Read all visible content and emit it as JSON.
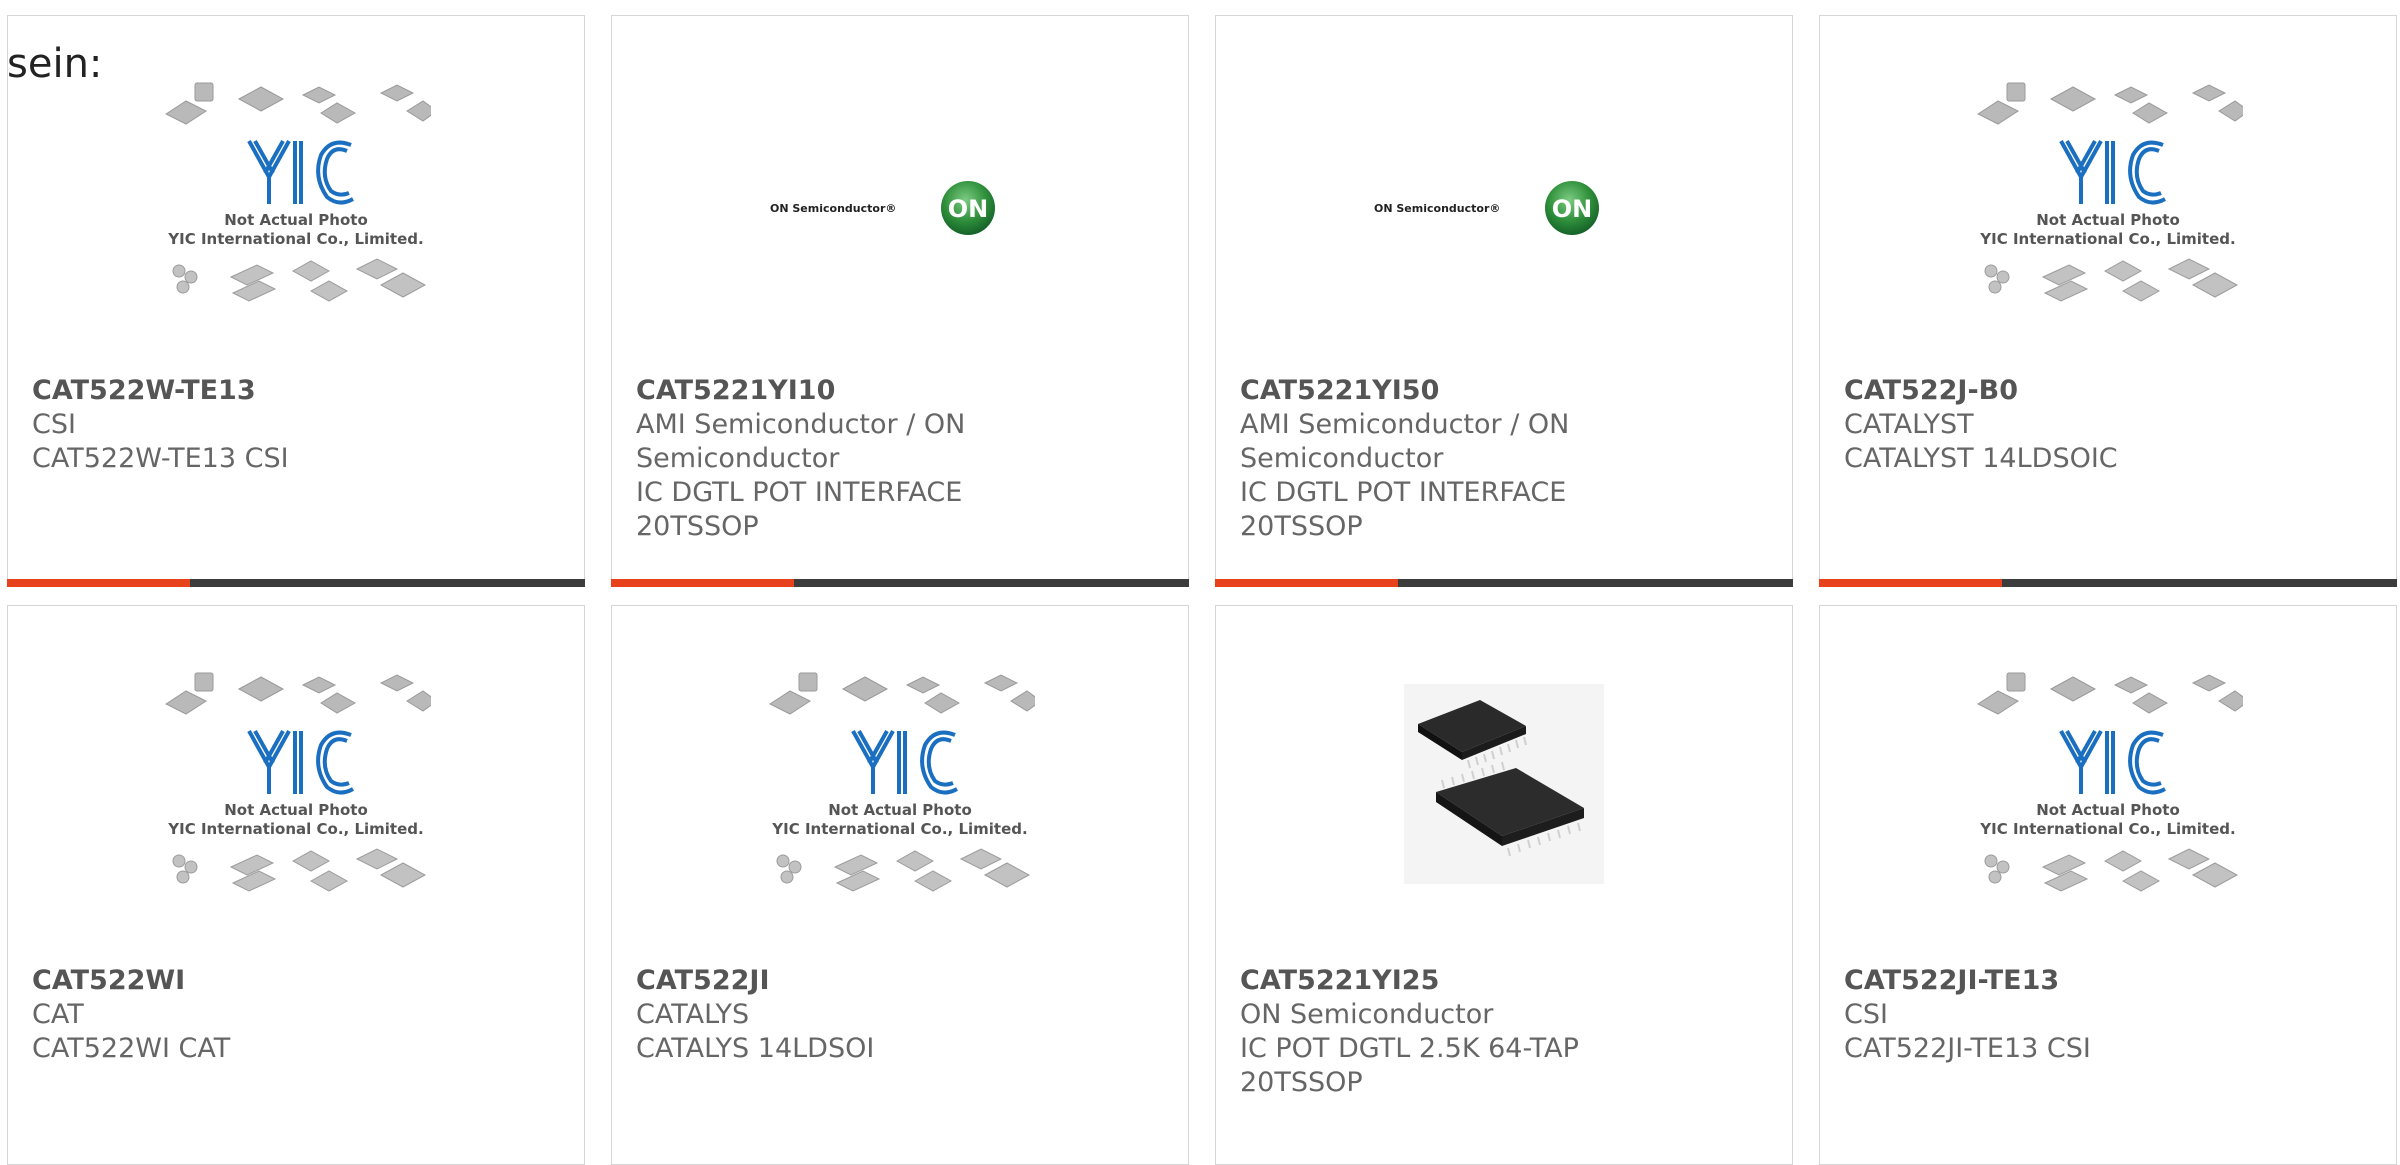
{
  "intro_text": "sein:",
  "colors": {
    "accent": "#e8421c",
    "bar": "#3c3c3c",
    "on_logo_green": "#2e8f3a",
    "yic_blue": "#1a6fc0"
  },
  "placeholder_image": {
    "logo_text": "YIC",
    "caption_line1": "Not Actual Photo",
    "caption_line2": "YIC International Co., Limited."
  },
  "on_logo": {
    "wordmark": "ON Semiconductor®",
    "badge": "ON"
  },
  "cards": [
    {
      "part": "CAT522W-TE13",
      "maker": "CSI",
      "desc": "CAT522W-TE13 CSI",
      "image": "yic-placeholder"
    },
    {
      "part": "CAT5221YI10",
      "maker": "AMI Semiconductor / ON Semiconductor",
      "desc": "IC DGTL POT INTERFACE 20TSSOP",
      "image": "on-semi-logo"
    },
    {
      "part": "CAT5221YI50",
      "maker": "AMI Semiconductor / ON Semiconductor",
      "desc": "IC DGTL POT INTERFACE 20TSSOP",
      "image": "on-semi-logo"
    },
    {
      "part": "CAT522J-B0",
      "maker": "CATALYST",
      "desc": "CATALYST 14LDSOIC",
      "image": "yic-placeholder"
    },
    {
      "part": "CAT522WI",
      "maker": "CAT",
      "desc": "CAT522WI CAT",
      "image": "yic-placeholder"
    },
    {
      "part": "CAT522JI",
      "maker": "CATALYS",
      "desc": "CATALYS 14LDSOI",
      "image": "yic-placeholder"
    },
    {
      "part": "CAT5221YI25",
      "maker": "ON Semiconductor",
      "desc": "IC POT DGTL 2.5K 64-TAP 20TSSOP",
      "image": "tssop-chip-photo"
    },
    {
      "part": "CAT522JI-TE13",
      "maker": "CSI",
      "desc": "CAT522JI-TE13 CSI",
      "image": "yic-placeholder"
    }
  ]
}
